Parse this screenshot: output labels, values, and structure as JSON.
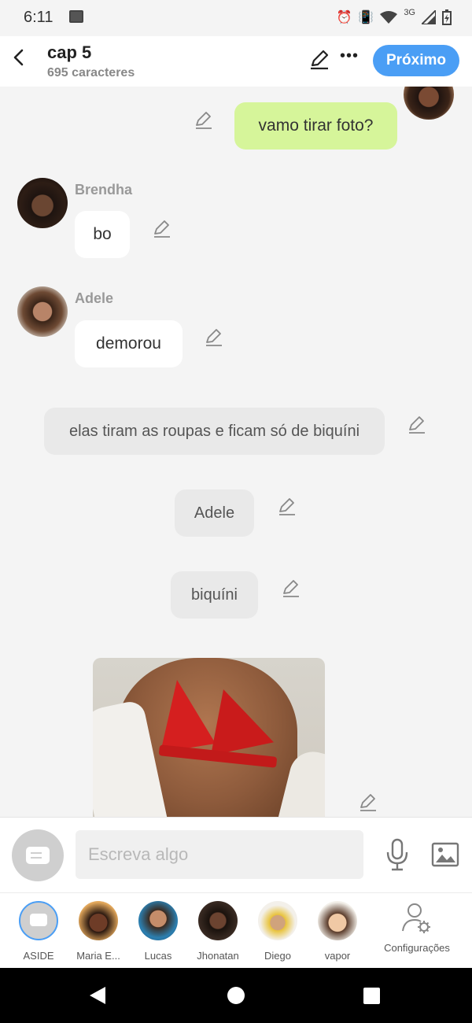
{
  "status_bar": {
    "time": "6:11",
    "network": "3G"
  },
  "header": {
    "title": "cap 5",
    "subtitle": "695 caracteres",
    "next_label": "Próximo"
  },
  "messages": [
    {
      "sender": "",
      "text": "vamo tirar foto?",
      "style": "outgoing-green"
    },
    {
      "sender": "Brendha",
      "text": "bo",
      "style": "incoming-white"
    },
    {
      "sender": "Adele",
      "text": "demorou",
      "style": "incoming-white"
    },
    {
      "sender": "",
      "text": "elas tiram as roupas e ficam só de biquíni",
      "style": "narration"
    },
    {
      "sender": "",
      "text": "Adele",
      "style": "narration"
    },
    {
      "sender": "",
      "text": "biquíni",
      "style": "narration"
    }
  ],
  "composer": {
    "placeholder": "Escreva algo"
  },
  "characters": [
    {
      "label": "ASIDE",
      "selected": true
    },
    {
      "label": "Maria E..."
    },
    {
      "label": "Lucas"
    },
    {
      "label": "Jhonatan"
    },
    {
      "label": "Diego"
    },
    {
      "label": "vapor"
    },
    {
      "label": "Configurações"
    }
  ],
  "colors": {
    "accent": "#4a9ef5",
    "outgoing_bubble": "#d6f59a",
    "narration_bubble": "#e9e9e9"
  }
}
